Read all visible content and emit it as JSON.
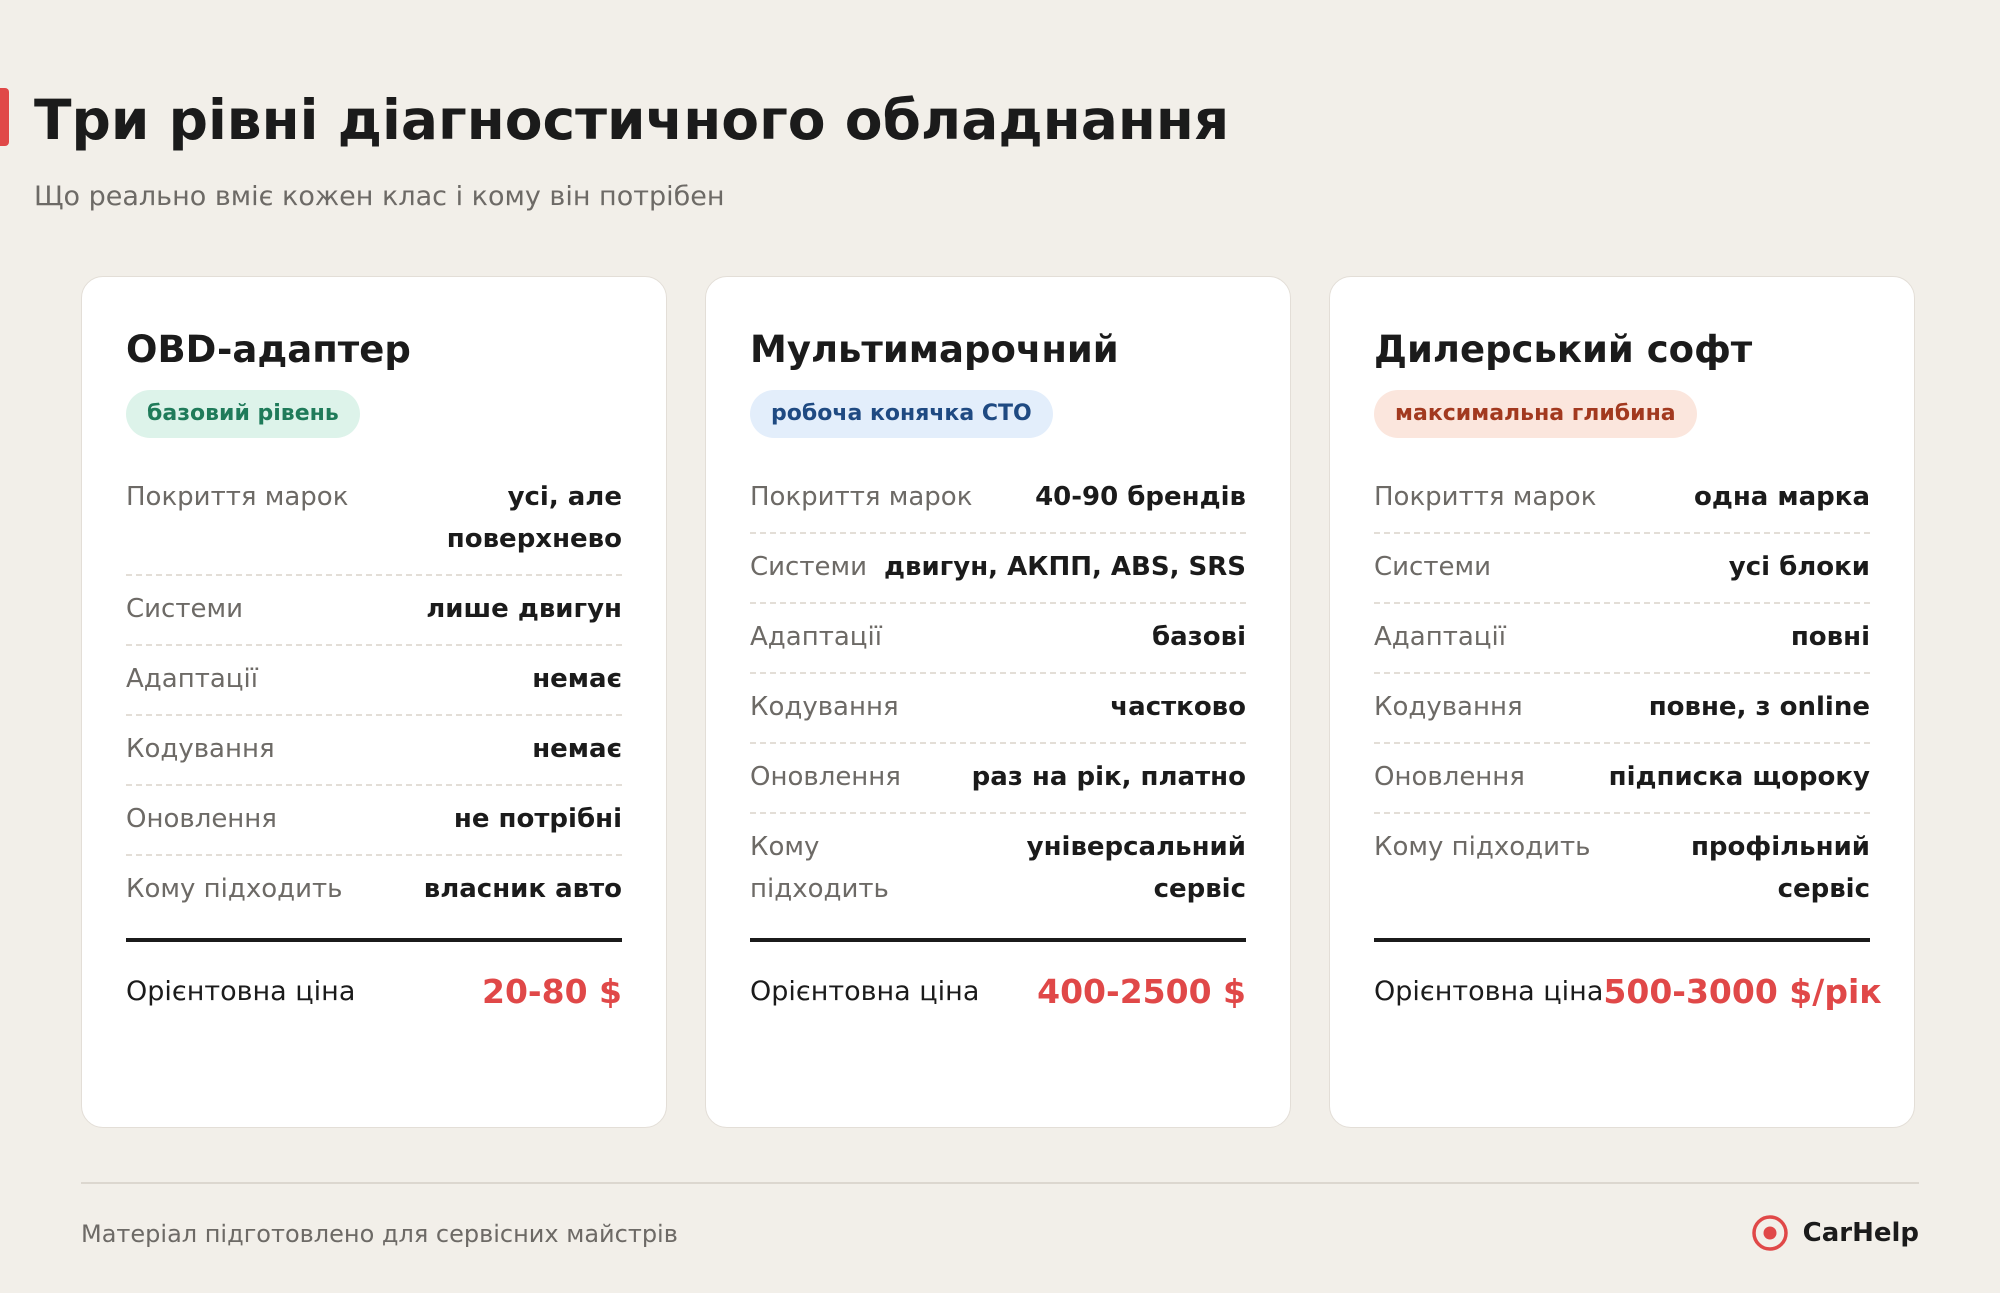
{
  "header": {
    "title": "Три рівні діагностичного обладнання",
    "subtitle": "Що реально вміє кожен клас і кому він потрібен"
  },
  "colors": {
    "accent": "#e04848",
    "background": "#f2efe9"
  },
  "cards": [
    {
      "title": "OBD-адаптер",
      "badge": "базовий рівень",
      "badge_bg": "#ddf3ea",
      "badge_fg": "#1f7b5a",
      "specs": [
        {
          "label": "Покриття марок",
          "value": "усі, але поверхнево"
        },
        {
          "label": "Системи",
          "value": "лише двигун"
        },
        {
          "label": "Адаптації",
          "value": "немає"
        },
        {
          "label": "Кодування",
          "value": "немає"
        },
        {
          "label": "Оновлення",
          "value": "не потрібні"
        },
        {
          "label": "Кому підходить",
          "value": "власник авто"
        }
      ],
      "price_label": "Орієнтовна ціна",
      "price": "20-80 $"
    },
    {
      "title": "Мультимарочний",
      "badge": "робоча конячка СТО",
      "badge_bg": "#e3eefb",
      "badge_fg": "#1f4a82",
      "specs": [
        {
          "label": "Покриття марок",
          "value": "40-90 брендів"
        },
        {
          "label": "Системи",
          "value": "двигун, АКПП, ABS, SRS"
        },
        {
          "label": "Адаптації",
          "value": "базові"
        },
        {
          "label": "Кодування",
          "value": "частково"
        },
        {
          "label": "Оновлення",
          "value": "раз на рік, платно"
        },
        {
          "label": "Кому підходить",
          "value": "універсальний сервіс"
        }
      ],
      "price_label": "Орієнтовна ціна",
      "price": "400-2500 $"
    },
    {
      "title": "Дилерський софт",
      "badge": "максимальна глибина",
      "badge_bg": "#fbe6dd",
      "badge_fg": "#a2391f",
      "specs": [
        {
          "label": "Покриття марок",
          "value": "одна марка"
        },
        {
          "label": "Системи",
          "value": "усі блоки"
        },
        {
          "label": "Адаптації",
          "value": "повні"
        },
        {
          "label": "Кодування",
          "value": "повне, з online"
        },
        {
          "label": "Оновлення",
          "value": "підписка щороку"
        },
        {
          "label": "Кому підходить",
          "value": "профільний сервіс"
        }
      ],
      "price_label": "Орієнтовна ціна",
      "price": "500-3000 $/рік"
    }
  ],
  "footer": {
    "text": "Матеріал підготовлено для сервісних майстрів",
    "brand": "CarHelp",
    "brand_icon": "target-icon"
  }
}
